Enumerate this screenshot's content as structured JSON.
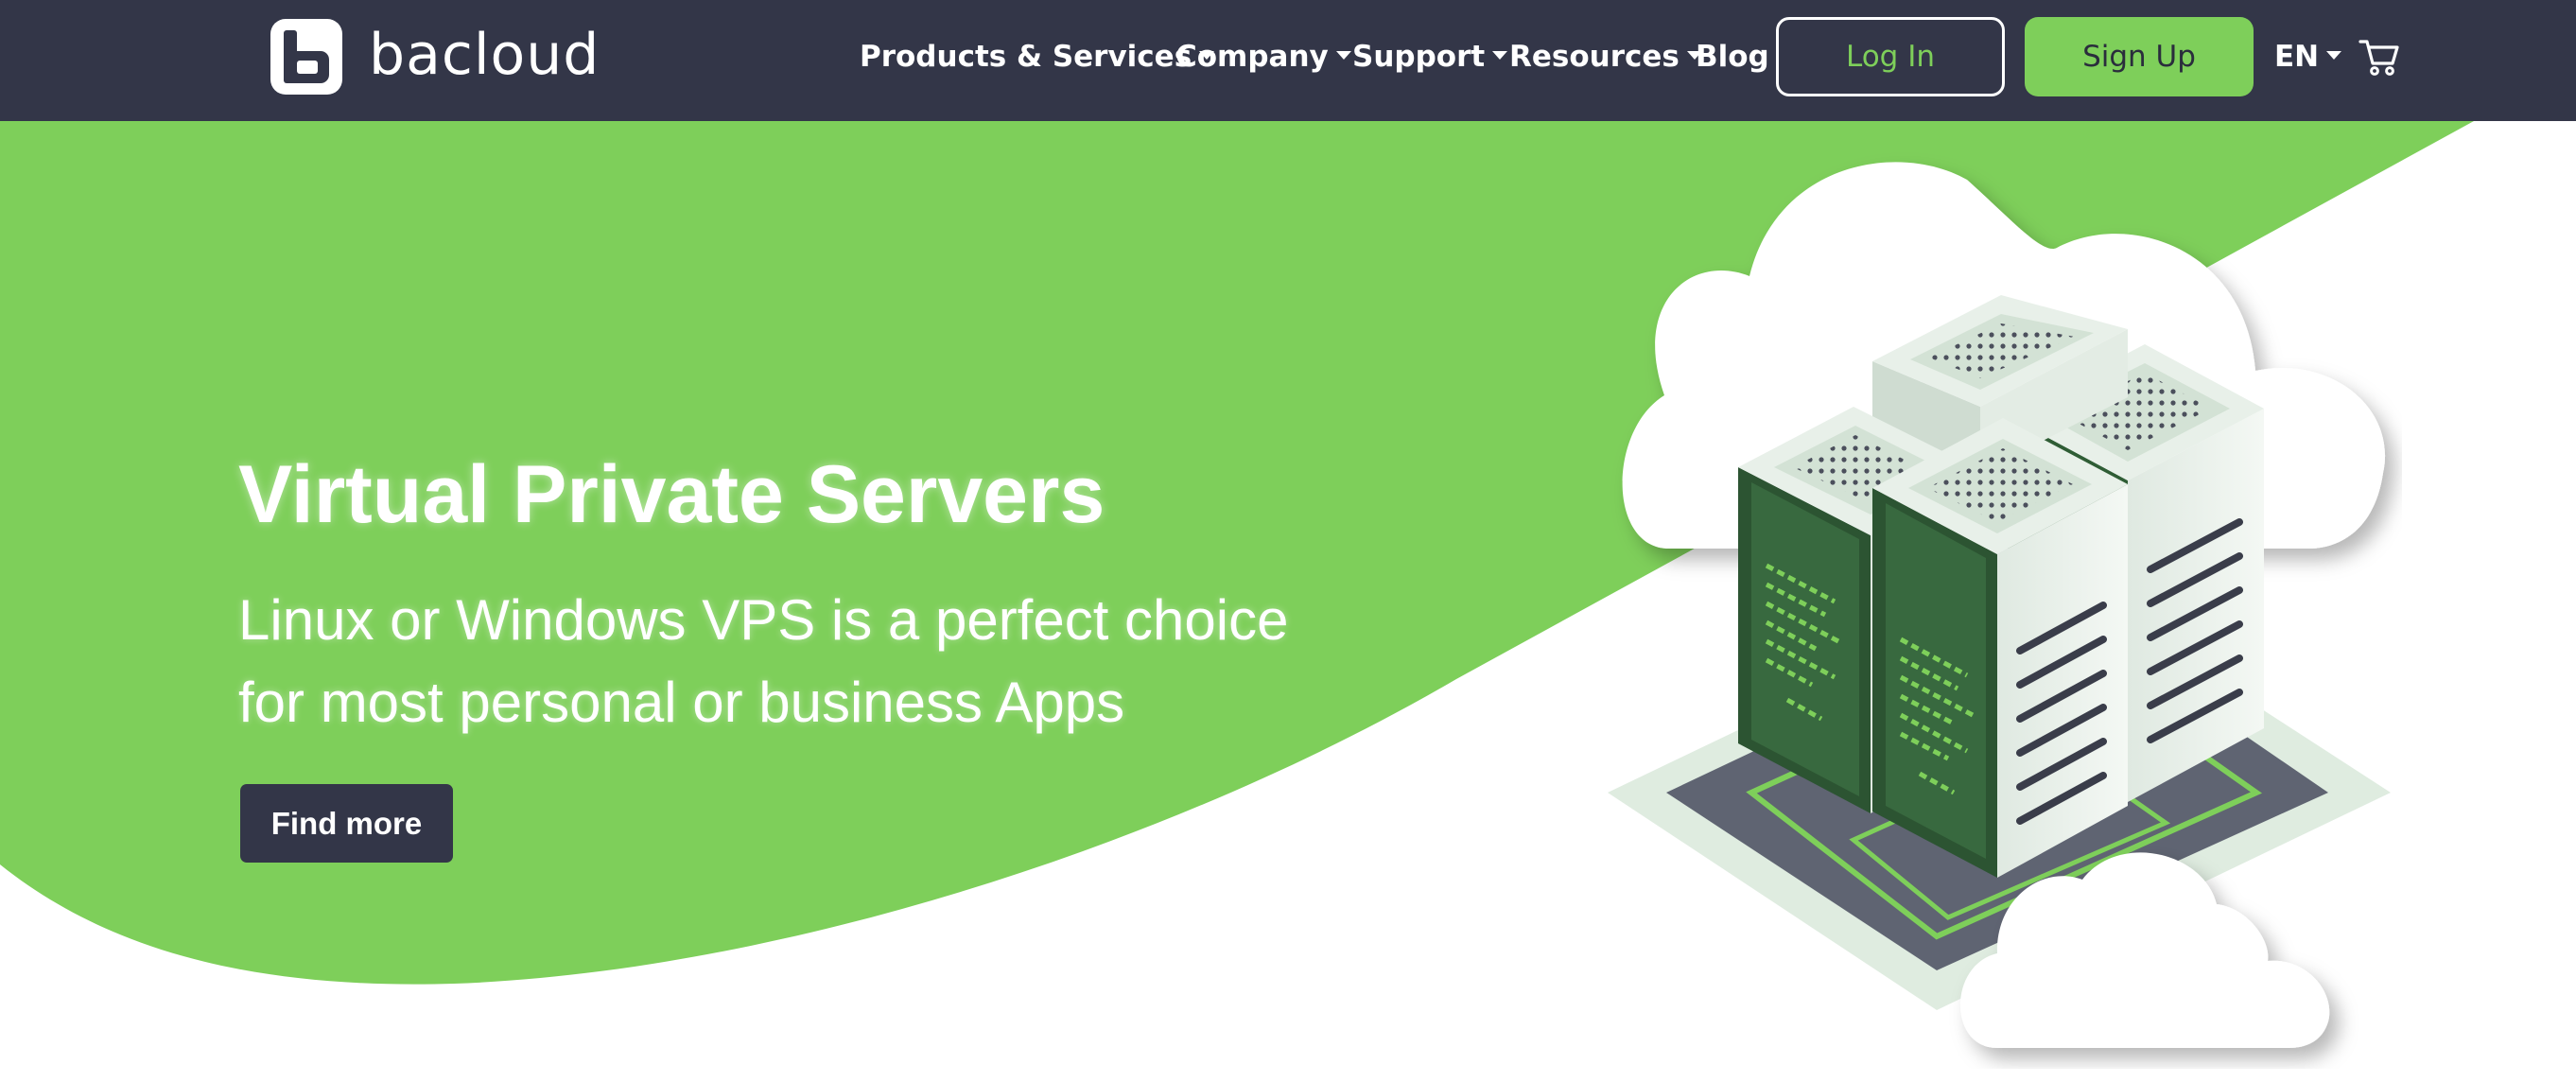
{
  "brand": {
    "name": "bacloud",
    "accent_color": "#7ecf5a",
    "header_color": "#333648"
  },
  "nav": {
    "items": [
      {
        "label": "Products & Services",
        "dropdown": true
      },
      {
        "label": "Company",
        "dropdown": true
      },
      {
        "label": "Support",
        "dropdown": true
      },
      {
        "label": "Resources",
        "dropdown": true
      },
      {
        "label": "Blog",
        "dropdown": false
      }
    ],
    "login_label": "Log In",
    "signup_label": "Sign Up",
    "language": "EN",
    "cart_icon": "cart-icon"
  },
  "hero": {
    "title": "Virtual Private Servers",
    "subtitle_line1": "Linux or Windows VPS is a perfect choice",
    "subtitle_line2": "for most personal or business Apps",
    "cta_label": "Find more",
    "illustration": "server-rack-cloud-icon"
  }
}
